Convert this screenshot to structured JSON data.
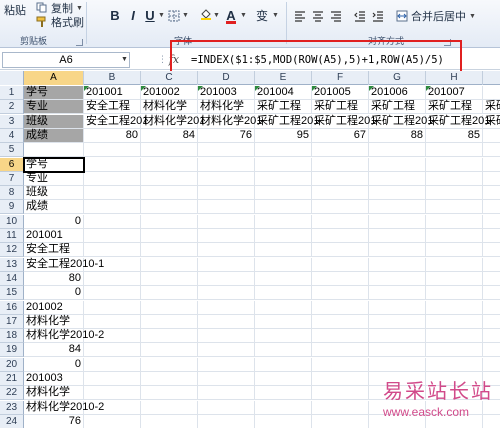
{
  "ribbon": {
    "paste_label": "粘贴",
    "copy_label": "复制",
    "format_painter_label": "格式刷",
    "clipboard_group": "剪贴板",
    "font_group": "字体",
    "align_group": "对齐方式",
    "bold": "B",
    "italic": "I",
    "underline": "U",
    "font_color_letter": "A",
    "wen_label": "变",
    "merge_center_label": "合并后居中"
  },
  "formula_bar": {
    "name_box": "A6",
    "fx": "fx",
    "formula": "=INDEX($1:$5,MOD(ROW(A5),5)+1,ROW(A5)/5)"
  },
  "columns": [
    "A",
    "B",
    "C",
    "D",
    "E",
    "F",
    "G",
    "H",
    "I"
  ],
  "rows": [
    {
      "n": "1",
      "cells": [
        "学号",
        "201001",
        "201002",
        "201003",
        "201004",
        "201005",
        "201006",
        "201007",
        "2010"
      ]
    },
    {
      "n": "2",
      "cells": [
        "专业",
        "安全工程",
        "材料化学",
        "材料化学",
        "采矿工程",
        "采矿工程",
        "采矿工程",
        "采矿工程",
        "采矿"
      ]
    },
    {
      "n": "3",
      "cells": [
        "班级",
        "安全工程201",
        "材料化学201",
        "材料化学201",
        "采矿工程201",
        "采矿工程201",
        "采矿工程201",
        "采矿工程201",
        "采矿"
      ]
    },
    {
      "n": "4",
      "cells": [
        "成绩",
        "80",
        "84",
        "76",
        "95",
        "67",
        "88",
        "85",
        ""
      ]
    },
    {
      "n": "5",
      "cells": [
        "",
        "",
        "",
        "",
        "",
        "",
        "",
        "",
        ""
      ]
    },
    {
      "n": "6",
      "cells": [
        "学号",
        "",
        "",
        "",
        "",
        "",
        "",
        "",
        ""
      ]
    },
    {
      "n": "7",
      "cells": [
        "专业",
        "",
        "",
        "",
        "",
        "",
        "",
        "",
        ""
      ]
    },
    {
      "n": "8",
      "cells": [
        "班级",
        "",
        "",
        "",
        "",
        "",
        "",
        "",
        ""
      ]
    },
    {
      "n": "9",
      "cells": [
        "成绩",
        "",
        "",
        "",
        "",
        "",
        "",
        "",
        ""
      ]
    },
    {
      "n": "10",
      "cells": [
        "0",
        "",
        "",
        "",
        "",
        "",
        "",
        "",
        ""
      ]
    },
    {
      "n": "11",
      "cells": [
        "201001",
        "",
        "",
        "",
        "",
        "",
        "",
        "",
        ""
      ]
    },
    {
      "n": "12",
      "cells": [
        "安全工程",
        "",
        "",
        "",
        "",
        "",
        "",
        "",
        ""
      ]
    },
    {
      "n": "13",
      "cells": [
        "安全工程2010-1",
        "",
        "",
        "",
        "",
        "",
        "",
        "",
        ""
      ]
    },
    {
      "n": "14",
      "cells": [
        "80",
        "",
        "",
        "",
        "",
        "",
        "",
        "",
        ""
      ]
    },
    {
      "n": "15",
      "cells": [
        "0",
        "",
        "",
        "",
        "",
        "",
        "",
        "",
        ""
      ]
    },
    {
      "n": "16",
      "cells": [
        "201002",
        "",
        "",
        "",
        "",
        "",
        "",
        "",
        ""
      ]
    },
    {
      "n": "17",
      "cells": [
        "材料化学",
        "",
        "",
        "",
        "",
        "",
        "",
        "",
        ""
      ]
    },
    {
      "n": "18",
      "cells": [
        "材料化学2010-2",
        "",
        "",
        "",
        "",
        "",
        "",
        "",
        ""
      ]
    },
    {
      "n": "19",
      "cells": [
        "84",
        "",
        "",
        "",
        "",
        "",
        "",
        "",
        ""
      ]
    },
    {
      "n": "20",
      "cells": [
        "0",
        "",
        "",
        "",
        "",
        "",
        "",
        "",
        ""
      ]
    },
    {
      "n": "21",
      "cells": [
        "201003",
        "",
        "",
        "",
        "",
        "",
        "",
        "",
        ""
      ]
    },
    {
      "n": "22",
      "cells": [
        "材料化学",
        "",
        "",
        "",
        "",
        "",
        "",
        "",
        ""
      ]
    },
    {
      "n": "23",
      "cells": [
        "材料化学2010-2",
        "",
        "",
        "",
        "",
        "",
        "",
        "",
        ""
      ]
    },
    {
      "n": "24",
      "cells": [
        "76",
        "",
        "",
        "",
        "",
        "",
        "",
        "",
        ""
      ]
    }
  ],
  "watermark": {
    "title": "易采站长站",
    "url": "www.easck.com"
  }
}
